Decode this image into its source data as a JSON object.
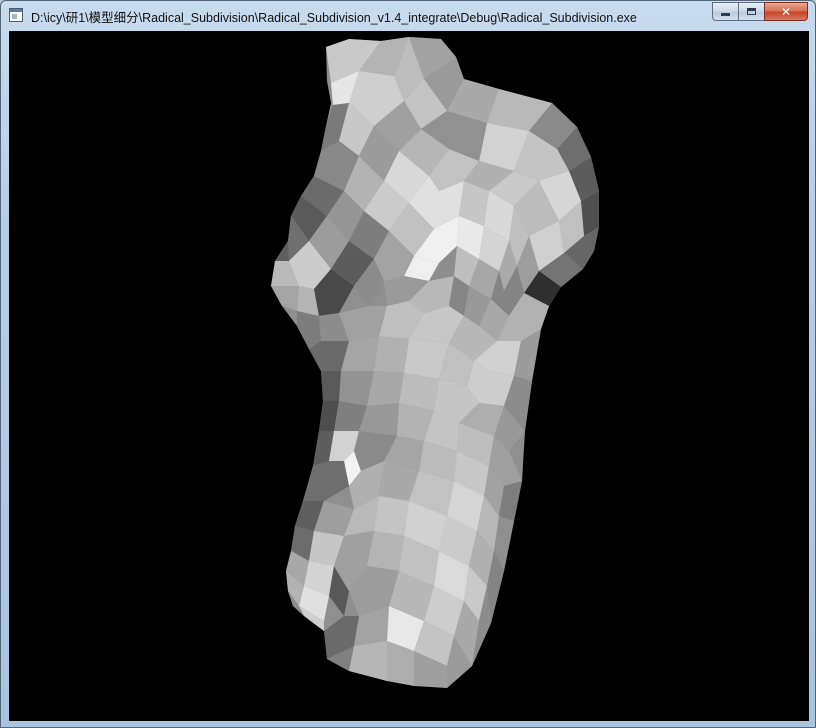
{
  "window": {
    "title": "D:\\icy\\研1\\模型细分\\Radical_Subdivision\\Radical_Subdivision_v1.4_integrate\\Debug\\Radical_Subdivision.exe",
    "controls": {
      "minimize_icon": "minimize-icon",
      "maximize_icon": "maximize-icon",
      "close_icon": "close-icon",
      "close_glyph": "✕"
    }
  },
  "viewport": {
    "background_color": "#000000",
    "model": "torso-mesh"
  }
}
